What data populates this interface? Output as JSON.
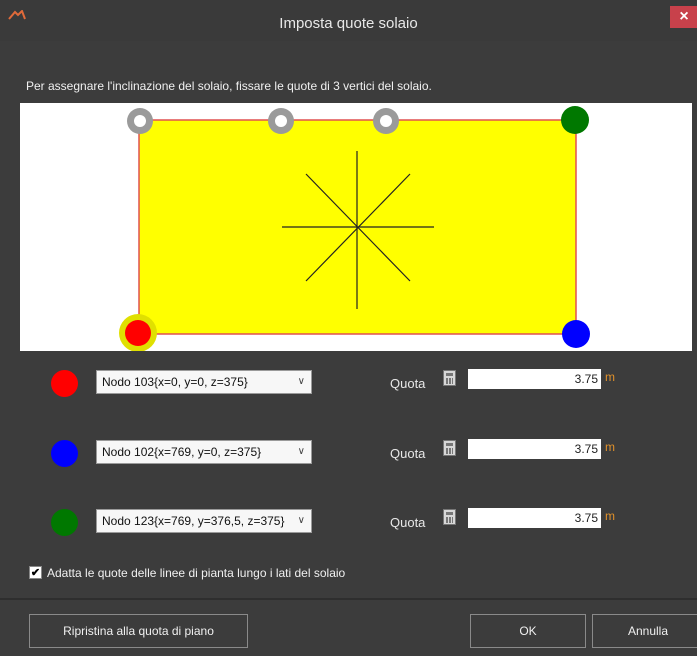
{
  "window": {
    "title": "Imposta quote solaio",
    "close_glyph": "×"
  },
  "instruction": "Per assegnare l'inclinazione del solaio, fissare le quote di 3 vertici del solaio.",
  "canvas": {
    "slab_color": "#ffff00",
    "slab_border": "#e05050",
    "handles": [
      {
        "name": "vertex-handle-gray",
        "state": "unselected",
        "color": "#9a9a9a"
      },
      {
        "name": "vertex-handle-gray",
        "state": "unselected",
        "color": "#9a9a9a"
      },
      {
        "name": "vertex-handle-gray",
        "state": "unselected",
        "color": "#9a9a9a"
      },
      {
        "name": "vertex-handle-green",
        "state": "selected",
        "color": "#007800"
      },
      {
        "name": "vertex-handle-red",
        "state": "selected",
        "color": "#ff0000"
      },
      {
        "name": "vertex-handle-blue",
        "state": "selected",
        "color": "#0000ff"
      }
    ]
  },
  "nodes": [
    {
      "color": "#ff0000",
      "value": "Nodo 103{x=0, y=0, z=375}",
      "quota_label": "Quota",
      "quota": "3.75",
      "unit": "m"
    },
    {
      "color": "#0000ff",
      "value": "Nodo 102{x=769, y=0, z=375}",
      "quota_label": "Quota",
      "quota": "3.75",
      "unit": "m"
    },
    {
      "color": "#007800",
      "value": "Nodo 123{x=769, y=376,5, z=375}",
      "quota_label": "Quota",
      "quota": "3.75",
      "unit": "m"
    }
  ],
  "adapt_checkbox": {
    "checked": true,
    "check_glyph": "✔",
    "label": "Adatta le quote delle linee di pianta lungo i lati del solaio"
  },
  "buttons": {
    "reset": "Ripristina alla quota di piano",
    "ok": "OK",
    "cancel": "Annulla"
  },
  "colors": {
    "background": "#3c3c3c",
    "accent_unit": "#e0902a"
  }
}
